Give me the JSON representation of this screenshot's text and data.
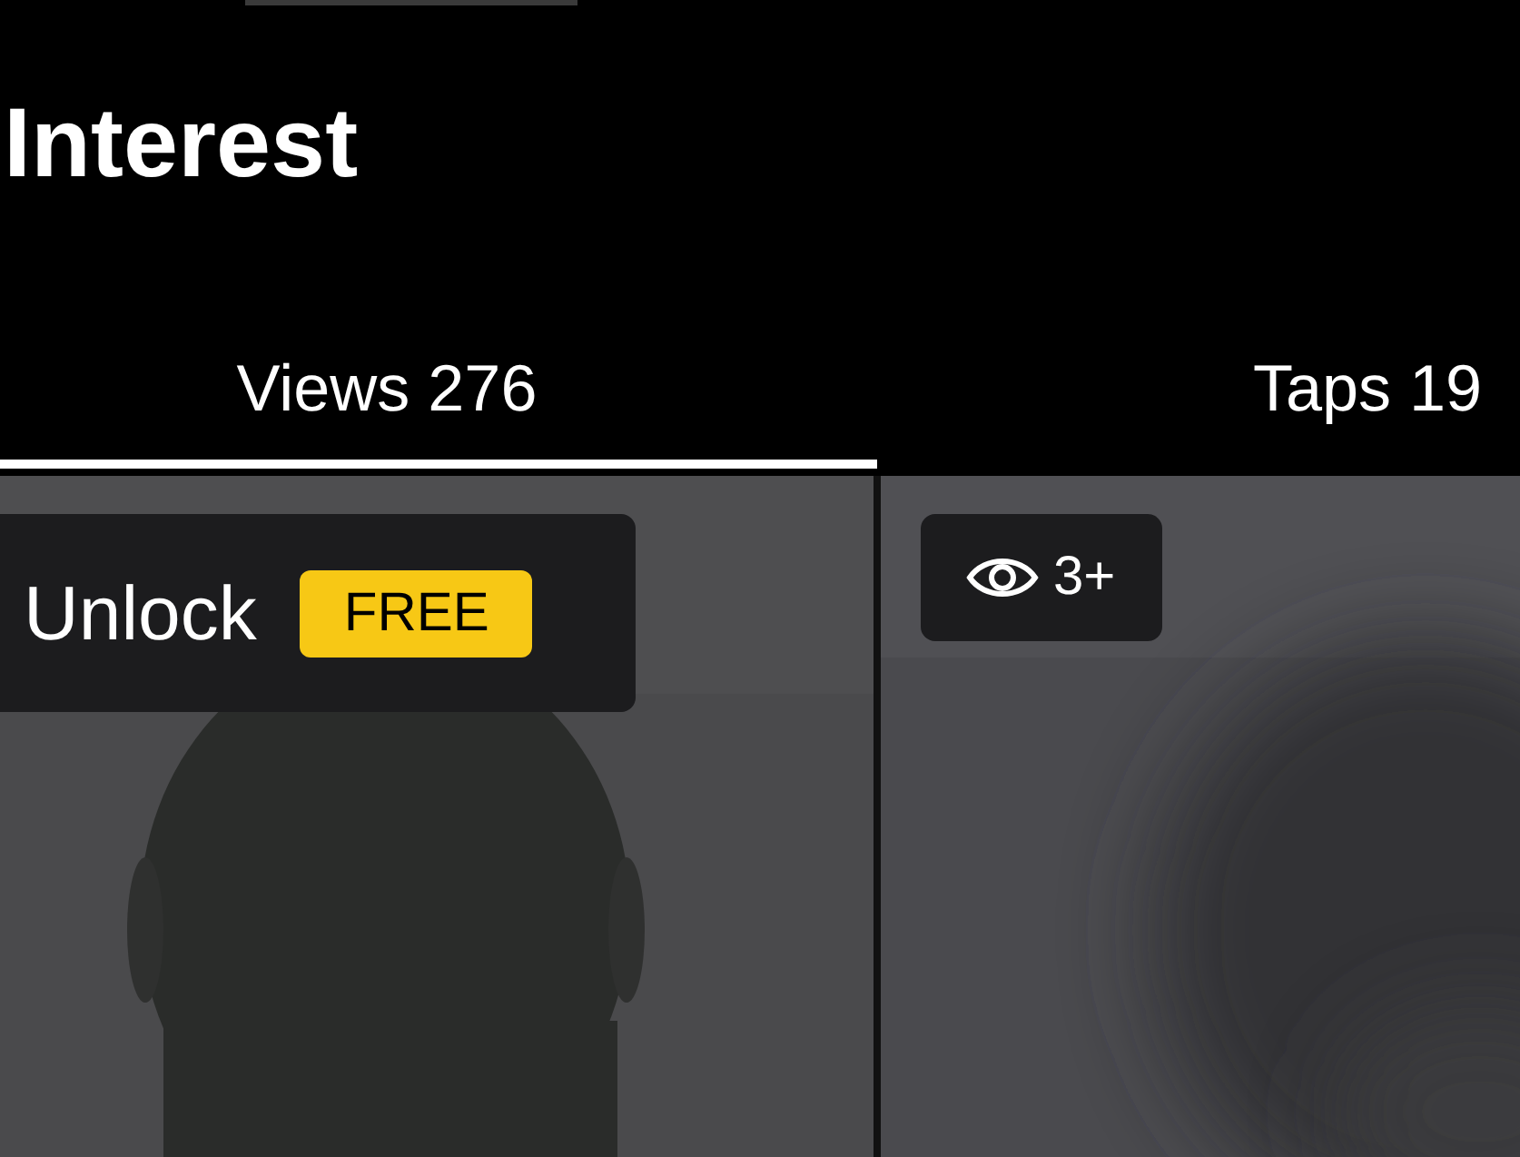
{
  "header": {
    "title": "Interest"
  },
  "tabs": [
    {
      "label": "Views 276",
      "selected": true
    },
    {
      "label": "Taps 19",
      "selected": false
    }
  ],
  "cards": [
    {
      "kind": "locked",
      "unlock_label": "Unlock",
      "badge": "FREE"
    },
    {
      "kind": "views",
      "count": "3+"
    }
  ]
}
